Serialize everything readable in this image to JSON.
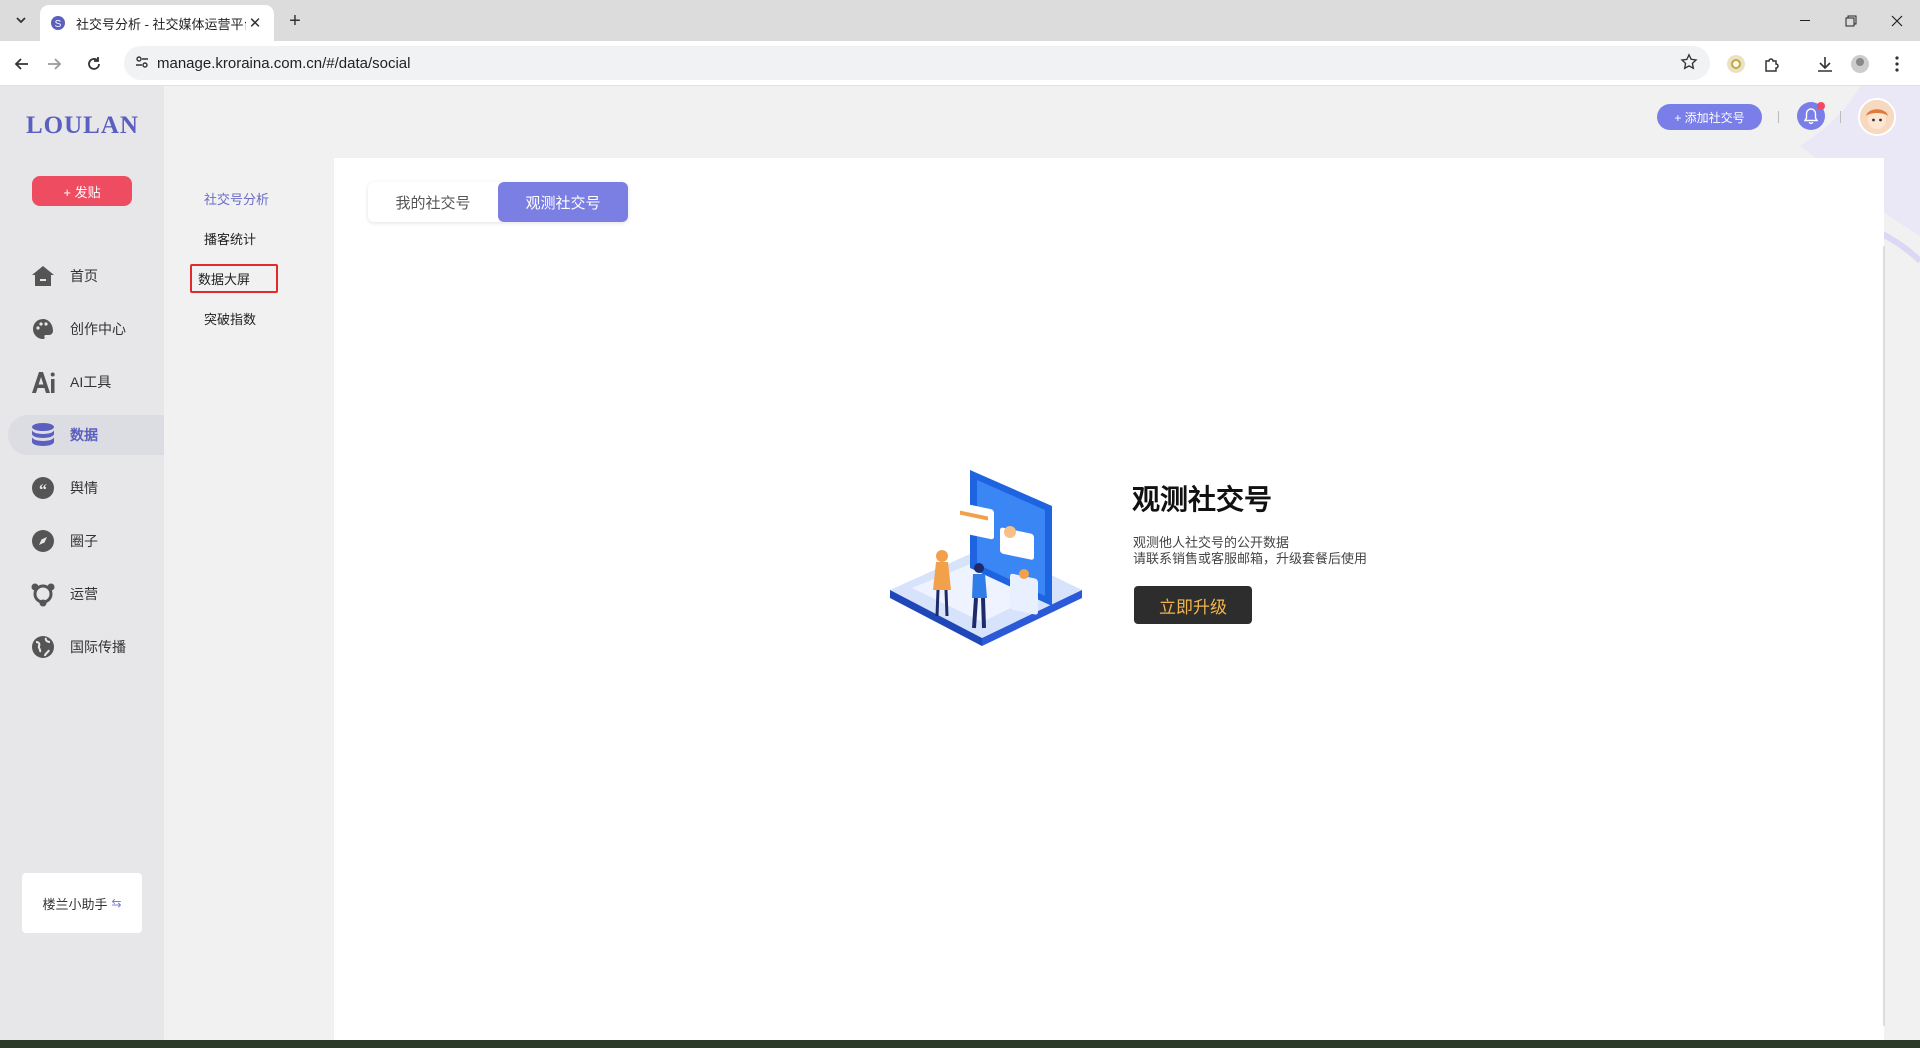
{
  "browser": {
    "tab_title": "社交号分析 - 社交媒体运营平台",
    "url": "manage.kroraina.com.cn/#/data/social"
  },
  "brand": {
    "logo": "LOULAN",
    "accent": "#7b7fe3",
    "post_color": "#ee4c61"
  },
  "sidebar": {
    "post_button": "+ 发贴",
    "items": [
      {
        "label": "首页",
        "icon": "home-icon"
      },
      {
        "label": "创作中心",
        "icon": "palette-icon"
      },
      {
        "label": "AI工具",
        "icon": "ai-icon"
      },
      {
        "label": "数据",
        "icon": "database-icon",
        "active": true
      },
      {
        "label": "舆情",
        "icon": "quote-icon"
      },
      {
        "label": "圈子",
        "icon": "compass-icon"
      },
      {
        "label": "运营",
        "icon": "operation-icon"
      },
      {
        "label": "国际传播",
        "icon": "globe-icon"
      }
    ],
    "helper": "楼兰小助手"
  },
  "subnav": {
    "items": [
      "社交号分析",
      "播客统计",
      "数据大屏",
      "突破指数"
    ]
  },
  "header": {
    "add_button": "+ 添加社交号"
  },
  "main": {
    "tabs": [
      {
        "label": "我的社交号"
      },
      {
        "label": "观测社交号",
        "active": true
      }
    ],
    "empty": {
      "title": "观测社交号",
      "desc1": "观测他人社交号的公开数据",
      "desc2": "请联系销售或客服邮箱，升级套餐后使用",
      "button": "立即升级"
    }
  }
}
